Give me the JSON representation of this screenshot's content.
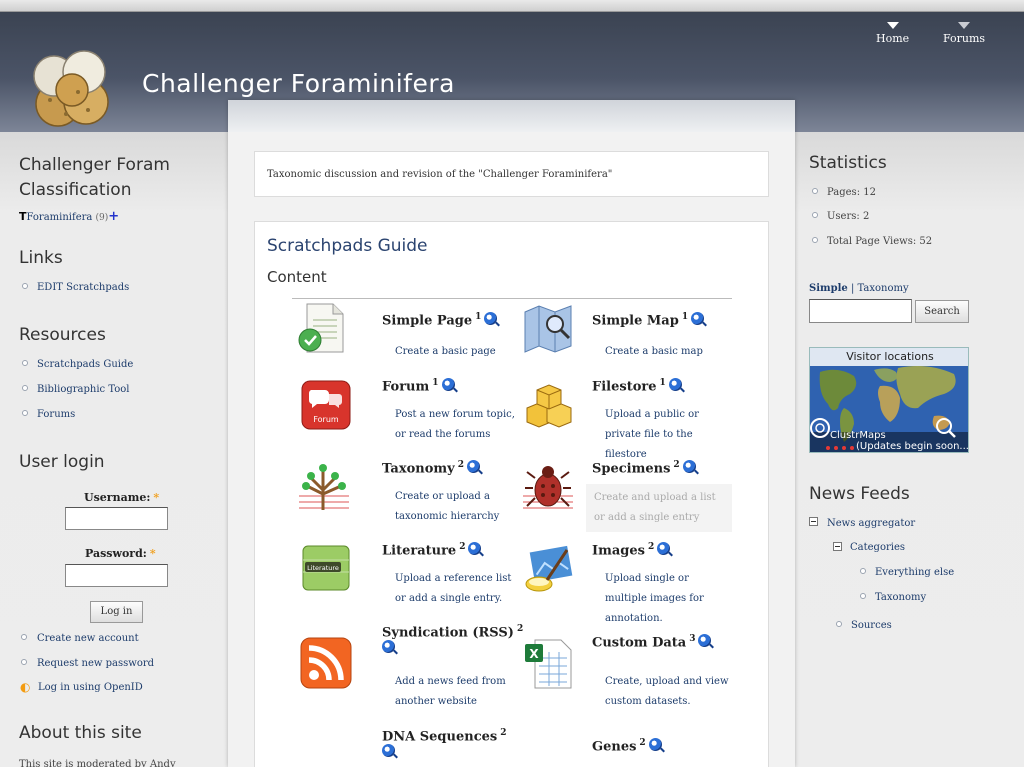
{
  "header": {
    "site_name": "Challenger Foraminifera",
    "nav": [
      {
        "label": "Home"
      },
      {
        "label": "Forums"
      }
    ]
  },
  "mission": "Taxonomic discussion and revision of the \"Challenger Foraminifera\"",
  "guide": {
    "title": "Scratchpads Guide",
    "subtitle": "Content",
    "items": [
      {
        "title": "Simple Page",
        "sup": "1",
        "icon": "page-icon",
        "desc": "Create a basic page"
      },
      {
        "title": "Simple Map",
        "sup": "1",
        "icon": "map-icon",
        "desc": "Create a basic map"
      },
      {
        "title": "Forum",
        "sup": "1",
        "icon": "forum-icon",
        "desc": "Post a new forum topic, or read the forums"
      },
      {
        "title": "Filestore",
        "sup": "1",
        "icon": "boxes-icon",
        "desc": "Upload a public or private file to the filestore"
      },
      {
        "title": "Taxonomy",
        "sup": "2",
        "icon": "tree-icon",
        "desc": "Create or upload a taxonomic hierarchy"
      },
      {
        "title": "Specimens",
        "sup": "2",
        "icon": "bug-icon",
        "desc": "Create and upload a list or add a single entry"
      },
      {
        "title": "Literature",
        "sup": "2",
        "icon": "literature-icon",
        "desc": "Upload a reference list or add a single entry."
      },
      {
        "title": "Images",
        "sup": "2",
        "icon": "images-icon",
        "desc": "Upload single or multiple images for annotation."
      },
      {
        "title": "Syndication (RSS)",
        "sup": "2",
        "icon": "rss-icon",
        "desc": "Add a news feed from another website"
      },
      {
        "title": "Custom Data",
        "sup": "3",
        "icon": "spreadsheet-icon",
        "desc": "Create, upload and view custom datasets."
      },
      {
        "title": "DNA Sequences",
        "sup": "2",
        "icon": "dna-icon",
        "desc": ""
      },
      {
        "title": "Genes",
        "sup": "2",
        "icon": "genes-icon",
        "desc": ""
      }
    ]
  },
  "left": {
    "classification_title": "Challenger Foram Classification",
    "classification_item": "Foraminifera",
    "classification_count": "(9)",
    "links_title": "Links",
    "links": [
      "EDIT Scratchpads"
    ],
    "resources_title": "Resources",
    "resources": [
      "Scratchpads Guide",
      "Bibliographic Tool",
      "Forums"
    ],
    "login_title": "User login",
    "username_label": "Username:",
    "password_label": "Password:",
    "required_mark": "*",
    "login_button": "Log in",
    "login_links": [
      "Create new account",
      "Request new password"
    ],
    "openid_link": "Log in using OpenID",
    "about_title": "About this site",
    "about_text": "This site is moderated by Andy"
  },
  "right": {
    "stats_title": "Statistics",
    "stats": [
      "Pages: 12",
      "Users: 2",
      "Total Page Views: 52"
    ],
    "search_tab_simple": "Simple",
    "search_tab_sep": "|",
    "search_tab_taxonomy": "Taxonomy",
    "search_button": "Search",
    "map_title": "Visitor locations",
    "map_brand": "ClustrMaps",
    "map_caption": "(Updates begin soon...)",
    "feeds_title": "News Feeds",
    "feeds": {
      "root": "News aggregator",
      "categories": "Categories",
      "cat_items": [
        "Everything else",
        "Taxonomy"
      ],
      "sources": "Sources"
    }
  },
  "colors": {
    "link": "#1d3c6b",
    "header": "#4b5467",
    "accent_required": "#f0a020"
  }
}
